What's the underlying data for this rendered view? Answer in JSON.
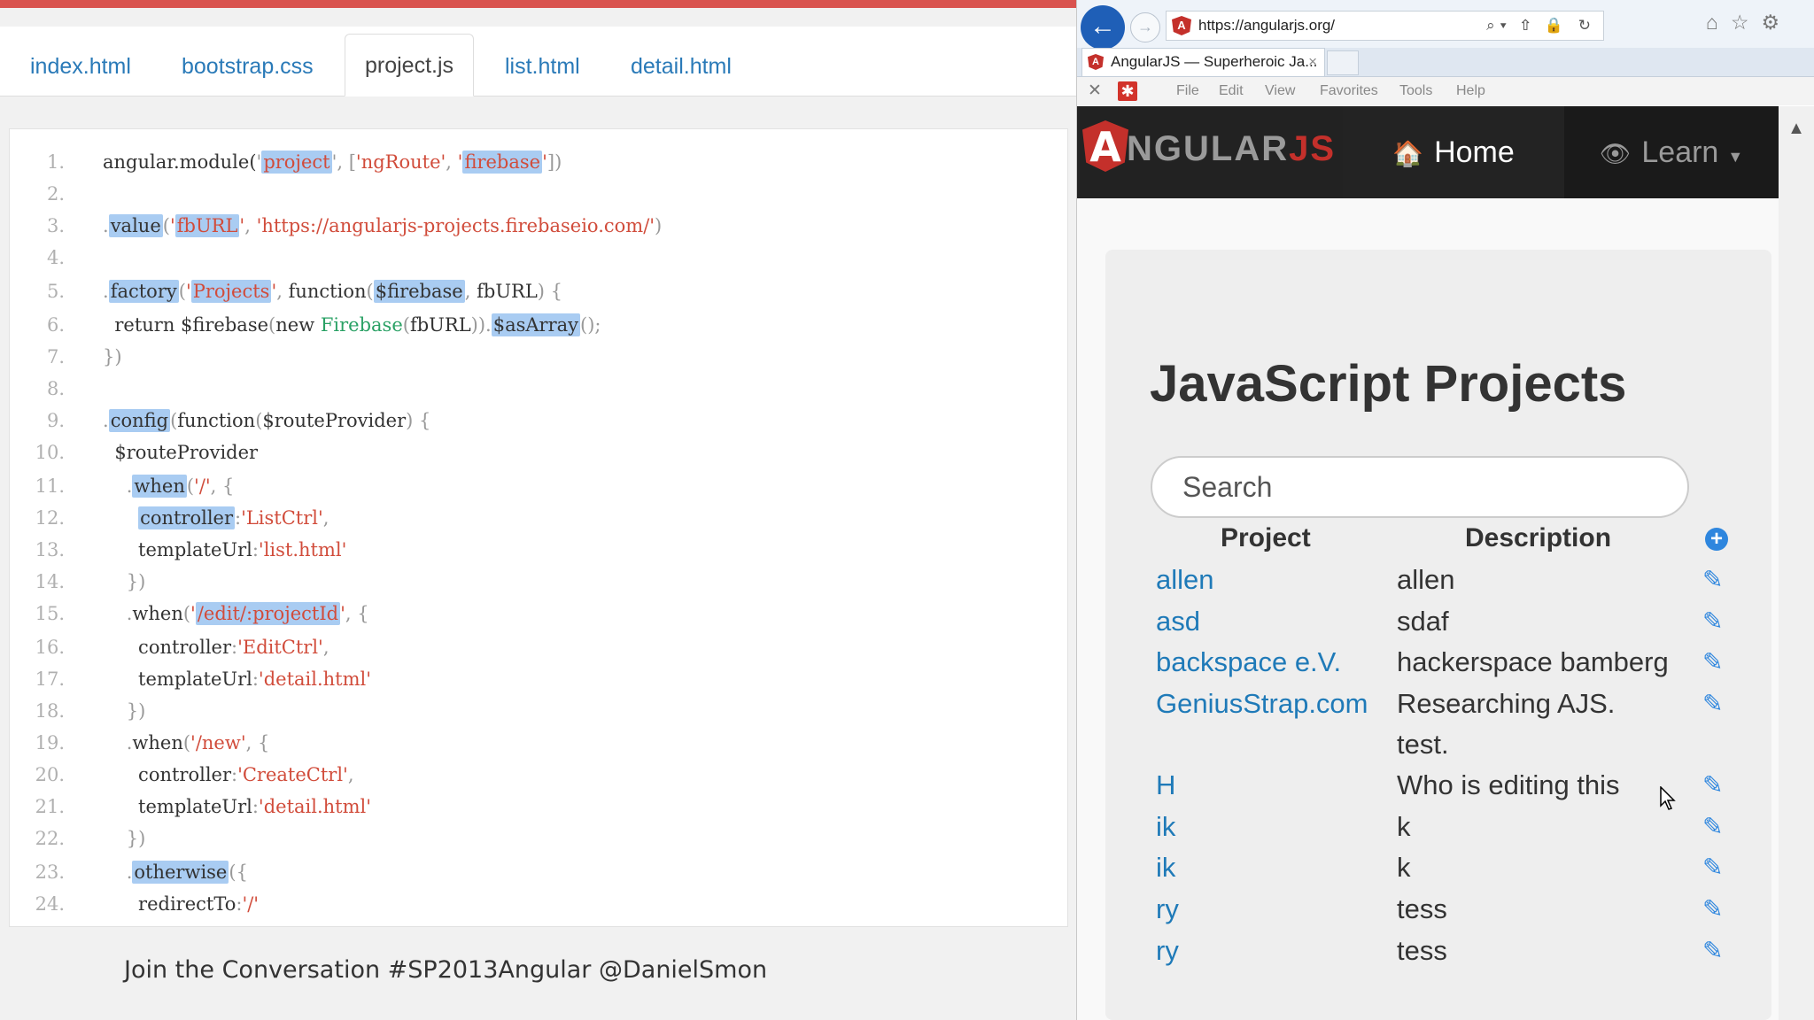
{
  "editor": {
    "tabs": [
      "index.html",
      "bootstrap.css",
      "project.js",
      "list.html",
      "detail.html"
    ],
    "active_tab": "project.js",
    "line_numbers": [
      "1.",
      "2.",
      "3.",
      "4.",
      "5.",
      "6.",
      "7.",
      "8.",
      "9.",
      "10.",
      "11.",
      "12.",
      "13.",
      "14.",
      "15.",
      "16.",
      "17.",
      "18.",
      "19.",
      "20.",
      "21.",
      "22.",
      "23.",
      "24."
    ],
    "lines": [
      "angular.module('project', ['ngRoute', 'firebase'])",
      "",
      ".value('fbURL', 'https://angularjs-projects.firebaseio.com/')",
      "",
      ".factory('Projects', function($firebase, fbURL) {",
      "  return $firebase(new Firebase(fbURL)).$asArray();",
      "})",
      "",
      ".config(function($routeProvider) {",
      "  $routeProvider",
      "    .when('/', {",
      "      controller:'ListCtrl',",
      "      templateUrl:'list.html'",
      "    })",
      "    .when('/edit/:projectId', {",
      "      controller:'EditCtrl',",
      "      templateUrl:'detail.html'",
      "    })",
      "    .when('/new', {",
      "      controller:'CreateCtrl',",
      "      templateUrl:'detail.html'",
      "    })",
      "    .otherwise({",
      "      redirectTo:'/'"
    ]
  },
  "footer": {
    "text": "Join the Conversation #SP2013Angular @DanielSmon"
  },
  "browser": {
    "url": "https://angularjs.org/",
    "tab_title": "AngularJS — Superheroic Ja...",
    "tab_close": "×",
    "menu": [
      "File",
      "Edit",
      "View",
      "Favorites",
      "Tools",
      "Help"
    ],
    "nav": {
      "logo_word": "NGULAR",
      "logo_js": "JS",
      "home": "Home",
      "learn": "Learn"
    }
  },
  "app": {
    "title": "JavaScript Projects",
    "search_placeholder": "Search",
    "columns": [
      "Project",
      "Description"
    ],
    "projects": [
      {
        "name": "allen",
        "description": "allen"
      },
      {
        "name": "asd",
        "description": "sdaf"
      },
      {
        "name": "backspace e.V.",
        "description": "hackerspace bamberg"
      },
      {
        "name": "GeniusStrap.com",
        "description": "Researching AJS. test."
      },
      {
        "name": "H",
        "description": "Who is editing this"
      },
      {
        "name": "ik",
        "description": "k"
      },
      {
        "name": "ik",
        "description": "k"
      },
      {
        "name": "ry",
        "description": "tess"
      },
      {
        "name": "ry",
        "description": "tess"
      }
    ]
  },
  "colors": {
    "top_accent": "#d9534f",
    "link": "#1f7ab8",
    "string": "#d14c3b",
    "highlight": "#a9ccf2",
    "angular_red": "#c4302b",
    "icon_blue": "#2e86de"
  },
  "icons": {
    "back": "arrow-left-icon",
    "forward": "arrow-right-icon",
    "home": "home-icon",
    "learn": "eye-icon",
    "add": "plus-circle-icon",
    "edit": "pencil-icon"
  }
}
